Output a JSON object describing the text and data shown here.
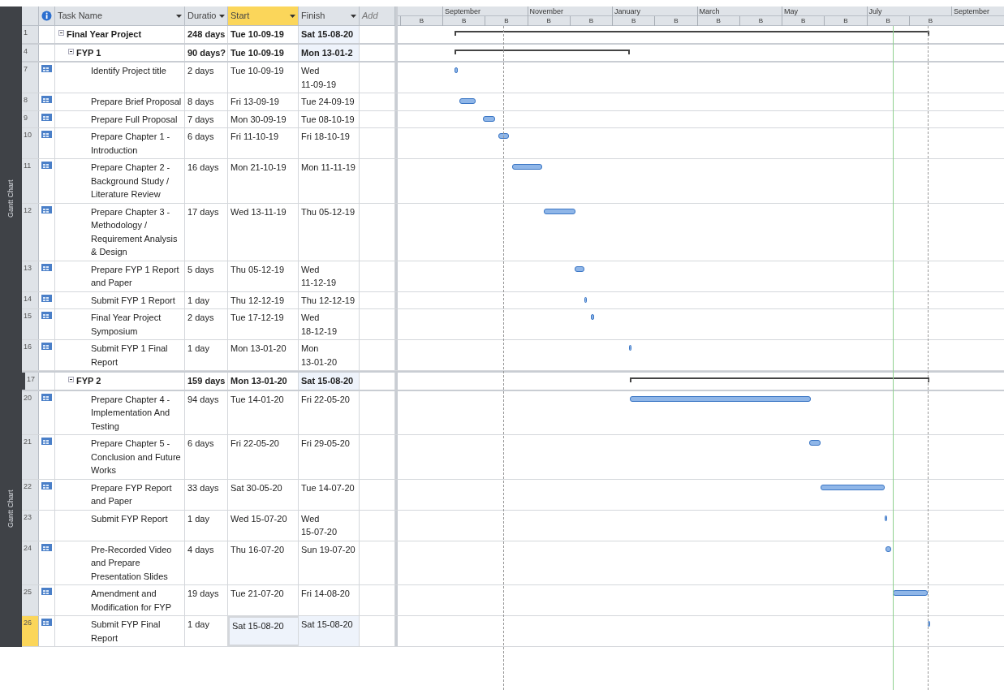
{
  "columns": [
    {
      "kind": "indicator"
    },
    {
      "kind": "name",
      "label": "Task Name",
      "selected": false
    },
    {
      "kind": "duration",
      "label": "Duratio",
      "selected": false
    },
    {
      "kind": "start",
      "label": "Start",
      "selected": true
    },
    {
      "kind": "finish",
      "label": "Finish",
      "selected": false
    },
    {
      "kind": "add",
      "label": "Add"
    }
  ],
  "timescale": {
    "months": [
      "September",
      "November",
      "January",
      "March",
      "May",
      "July",
      "September"
    ],
    "units": [
      "B",
      "B",
      "B",
      "B",
      "B",
      "B",
      "B",
      "B",
      "B",
      "B",
      "B",
      "B",
      "B"
    ]
  },
  "side_labels": [
    "Gantt Chart",
    "Gantt Chart"
  ],
  "tasks": [
    {
      "id": "1",
      "name": "Final Year Project",
      "duration": "248 days",
      "start": "Tue 10-09-19",
      "finish": "Sat 15-08-20",
      "kind": "summary",
      "indicator": false,
      "selected": false,
      "children": [
        {
          "id": "4",
          "name": "FYP 1",
          "duration": "90 days?",
          "start": "Tue 10-09-19",
          "finish": "Mon 13-01-2",
          "kind": "summary",
          "indicator": false,
          "selected": false,
          "children": [
            {
              "id": "7",
              "name": "Identify Project title",
              "duration": "2 days",
              "start": "Tue 10-09-19",
              "finish": "Wed 11-09-19",
              "kind": "task",
              "indicator": true,
              "selected": false
            },
            {
              "id": "8",
              "name": "Prepare Brief Proposal",
              "duration": "8 days",
              "start": "Fri 13-09-19",
              "finish": "Tue 24-09-19",
              "kind": "task",
              "indicator": true,
              "selected": false
            },
            {
              "id": "9",
              "name": "Prepare Full Proposal",
              "duration": "7 days",
              "start": "Mon 30-09-19",
              "finish": "Tue 08-10-19",
              "kind": "task",
              "indicator": true,
              "selected": false
            },
            {
              "id": "10",
              "name": "Prepare Chapter 1 - Introduction",
              "duration": "6 days",
              "start": "Fri 11-10-19",
              "finish": "Fri 18-10-19",
              "kind": "task",
              "indicator": true,
              "selected": false
            },
            {
              "id": "11",
              "name": "Prepare Chapter 2 - Background Study / Literature Review",
              "duration": "16 days",
              "start": "Mon 21-10-19",
              "finish": "Mon 11-11-19",
              "kind": "task",
              "indicator": true,
              "selected": false
            },
            {
              "id": "12",
              "name": "Prepare Chapter 3 - Methodology / Requirement Analysis & Design",
              "duration": "17 days",
              "start": "Wed 13-11-19",
              "finish": "Thu 05-12-19",
              "kind": "task",
              "indicator": true,
              "selected": false
            },
            {
              "id": "13",
              "name": "Prepare FYP 1 Report and Paper",
              "duration": "5 days",
              "start": "Thu 05-12-19",
              "finish": "Wed 11-12-19",
              "kind": "task",
              "indicator": true,
              "selected": false
            },
            {
              "id": "14",
              "name": "Submit FYP 1 Report",
              "duration": "1 day",
              "start": "Thu 12-12-19",
              "finish": "Thu 12-12-19",
              "kind": "task",
              "indicator": true,
              "selected": false
            },
            {
              "id": "15",
              "name": "Final Year Project Symposium",
              "duration": "2 days",
              "start": "Tue 17-12-19",
              "finish": "Wed 18-12-19",
              "kind": "task",
              "indicator": true,
              "selected": false
            },
            {
              "id": "16",
              "name": "Submit FYP 1 Final Report",
              "duration": "1 day",
              "start": "Mon 13-01-20",
              "finish": "Mon 13-01-20",
              "kind": "task",
              "indicator": true,
              "selected": false
            }
          ]
        },
        {
          "id": "17",
          "name": "FYP 2",
          "duration": "159 days",
          "start": "Mon 13-01-20",
          "finish": "Sat 15-08-20",
          "kind": "summary",
          "indicator": false,
          "selected": false,
          "new_pane": true,
          "children": [
            {
              "id": "20",
              "name": "Prepare Chapter 4 - Implementation And Testing",
              "duration": "94 days",
              "start": "Tue 14-01-20",
              "finish": "Fri 22-05-20",
              "kind": "task",
              "indicator": true,
              "selected": false
            },
            {
              "id": "21",
              "name": "Prepare Chapter 5 - Conclusion and Future Works",
              "duration": "6 days",
              "start": "Fri 22-05-20",
              "finish": "Fri 29-05-20",
              "kind": "task",
              "indicator": true,
              "selected": false
            },
            {
              "id": "22",
              "name": "Prepare FYP Report and Paper",
              "duration": "33 days",
              "start": "Sat 30-05-20",
              "finish": "Tue 14-07-20",
              "kind": "task",
              "indicator": true,
              "selected": false
            },
            {
              "id": "23",
              "name": "Submit FYP Report",
              "duration": "1 day",
              "start": "Wed 15-07-20",
              "finish": "Wed 15-07-20",
              "kind": "task",
              "indicator": false,
              "selected": false
            },
            {
              "id": "24",
              "name": "Pre-Recorded Video and Prepare Presentation Slides",
              "duration": "4 days",
              "start": "Thu 16-07-20",
              "finish": "Sun 19-07-20",
              "kind": "task",
              "indicator": true,
              "selected": false
            },
            {
              "id": "25",
              "name": "Amendment and Modification for FYP",
              "duration": "19 days",
              "start": "Tue 21-07-20",
              "finish": "Fri 14-08-20",
              "kind": "task",
              "indicator": true,
              "selected": false
            },
            {
              "id": "26",
              "name": "Submit FYP Final Report",
              "duration": "1 day",
              "start": "Sat 15-08-20",
              "finish": "Sat 15-08-20",
              "kind": "task",
              "indicator": true,
              "selected": true
            }
          ]
        }
      ]
    }
  ]
}
